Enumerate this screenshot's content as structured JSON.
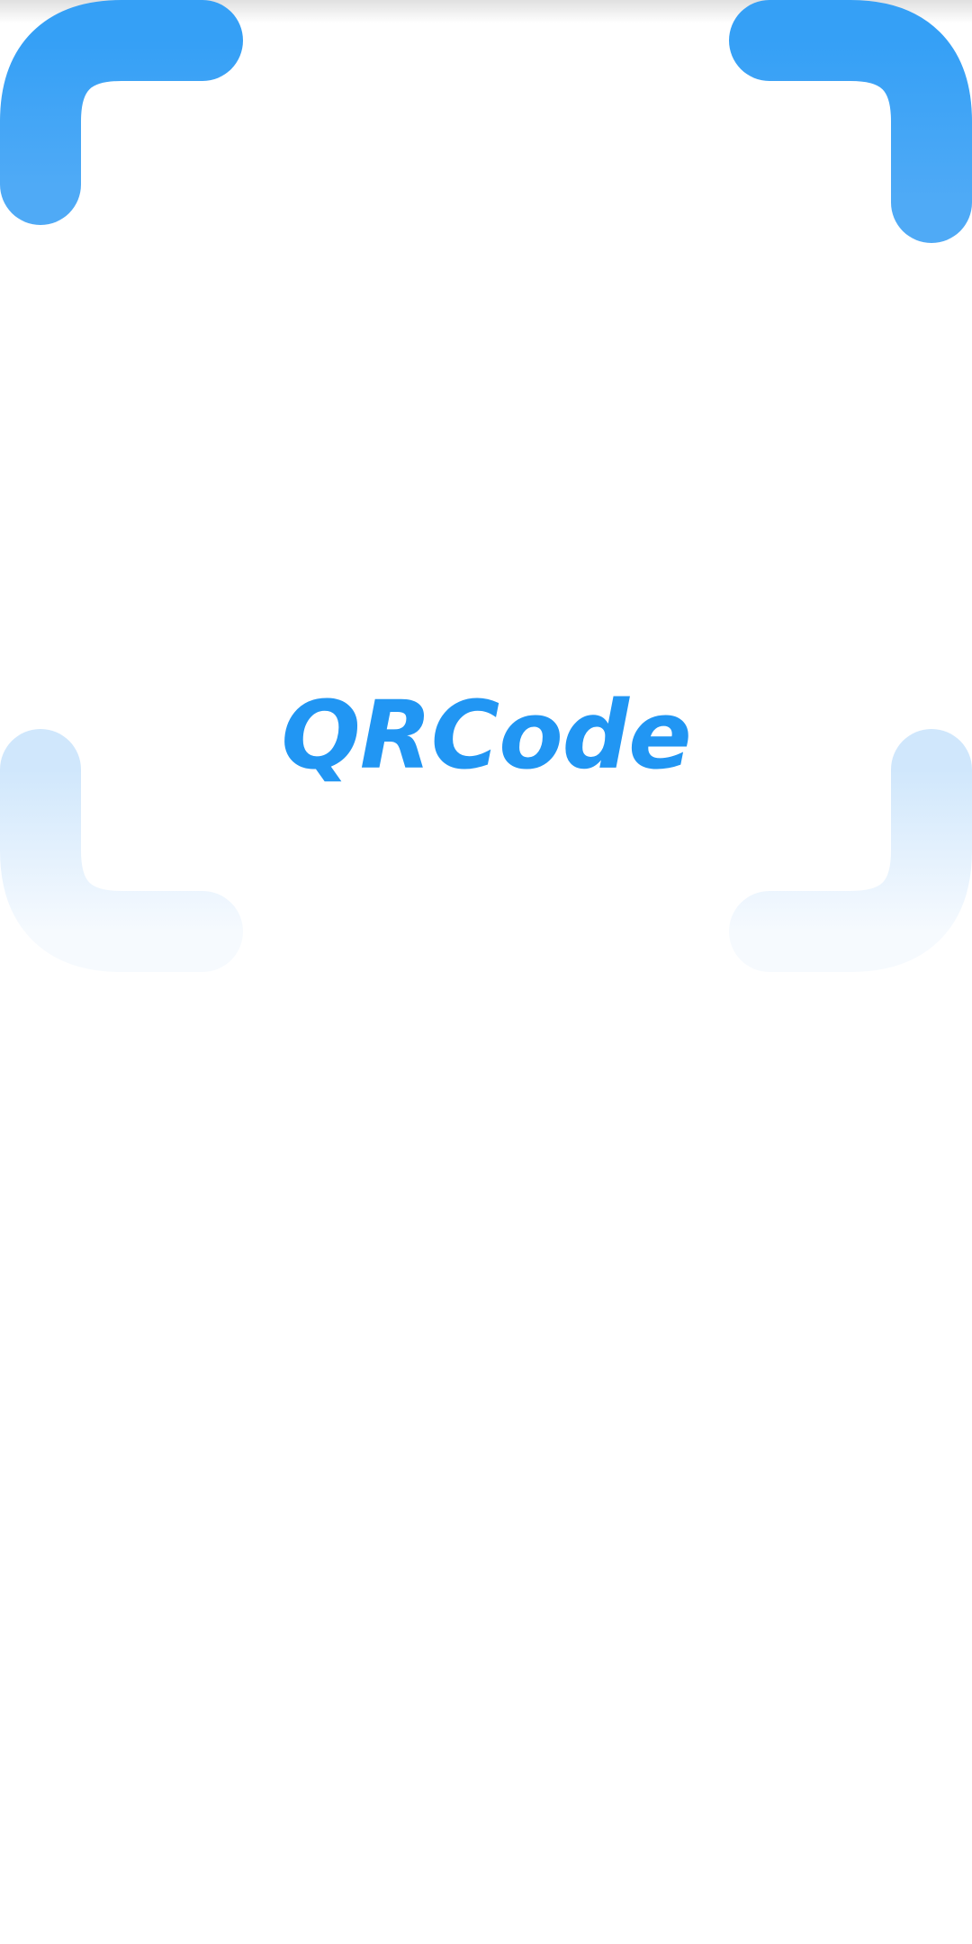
{
  "app": {
    "title": "QRCode"
  },
  "logo": {
    "icon": "qr-scanner-icon",
    "colors": {
      "primary": "#2196F3",
      "corner_top": "#3EA2F6",
      "scan_line": "#90CAF9",
      "corner_bottom_light": "#D2E8FC"
    }
  },
  "background": "#FFFFFF"
}
